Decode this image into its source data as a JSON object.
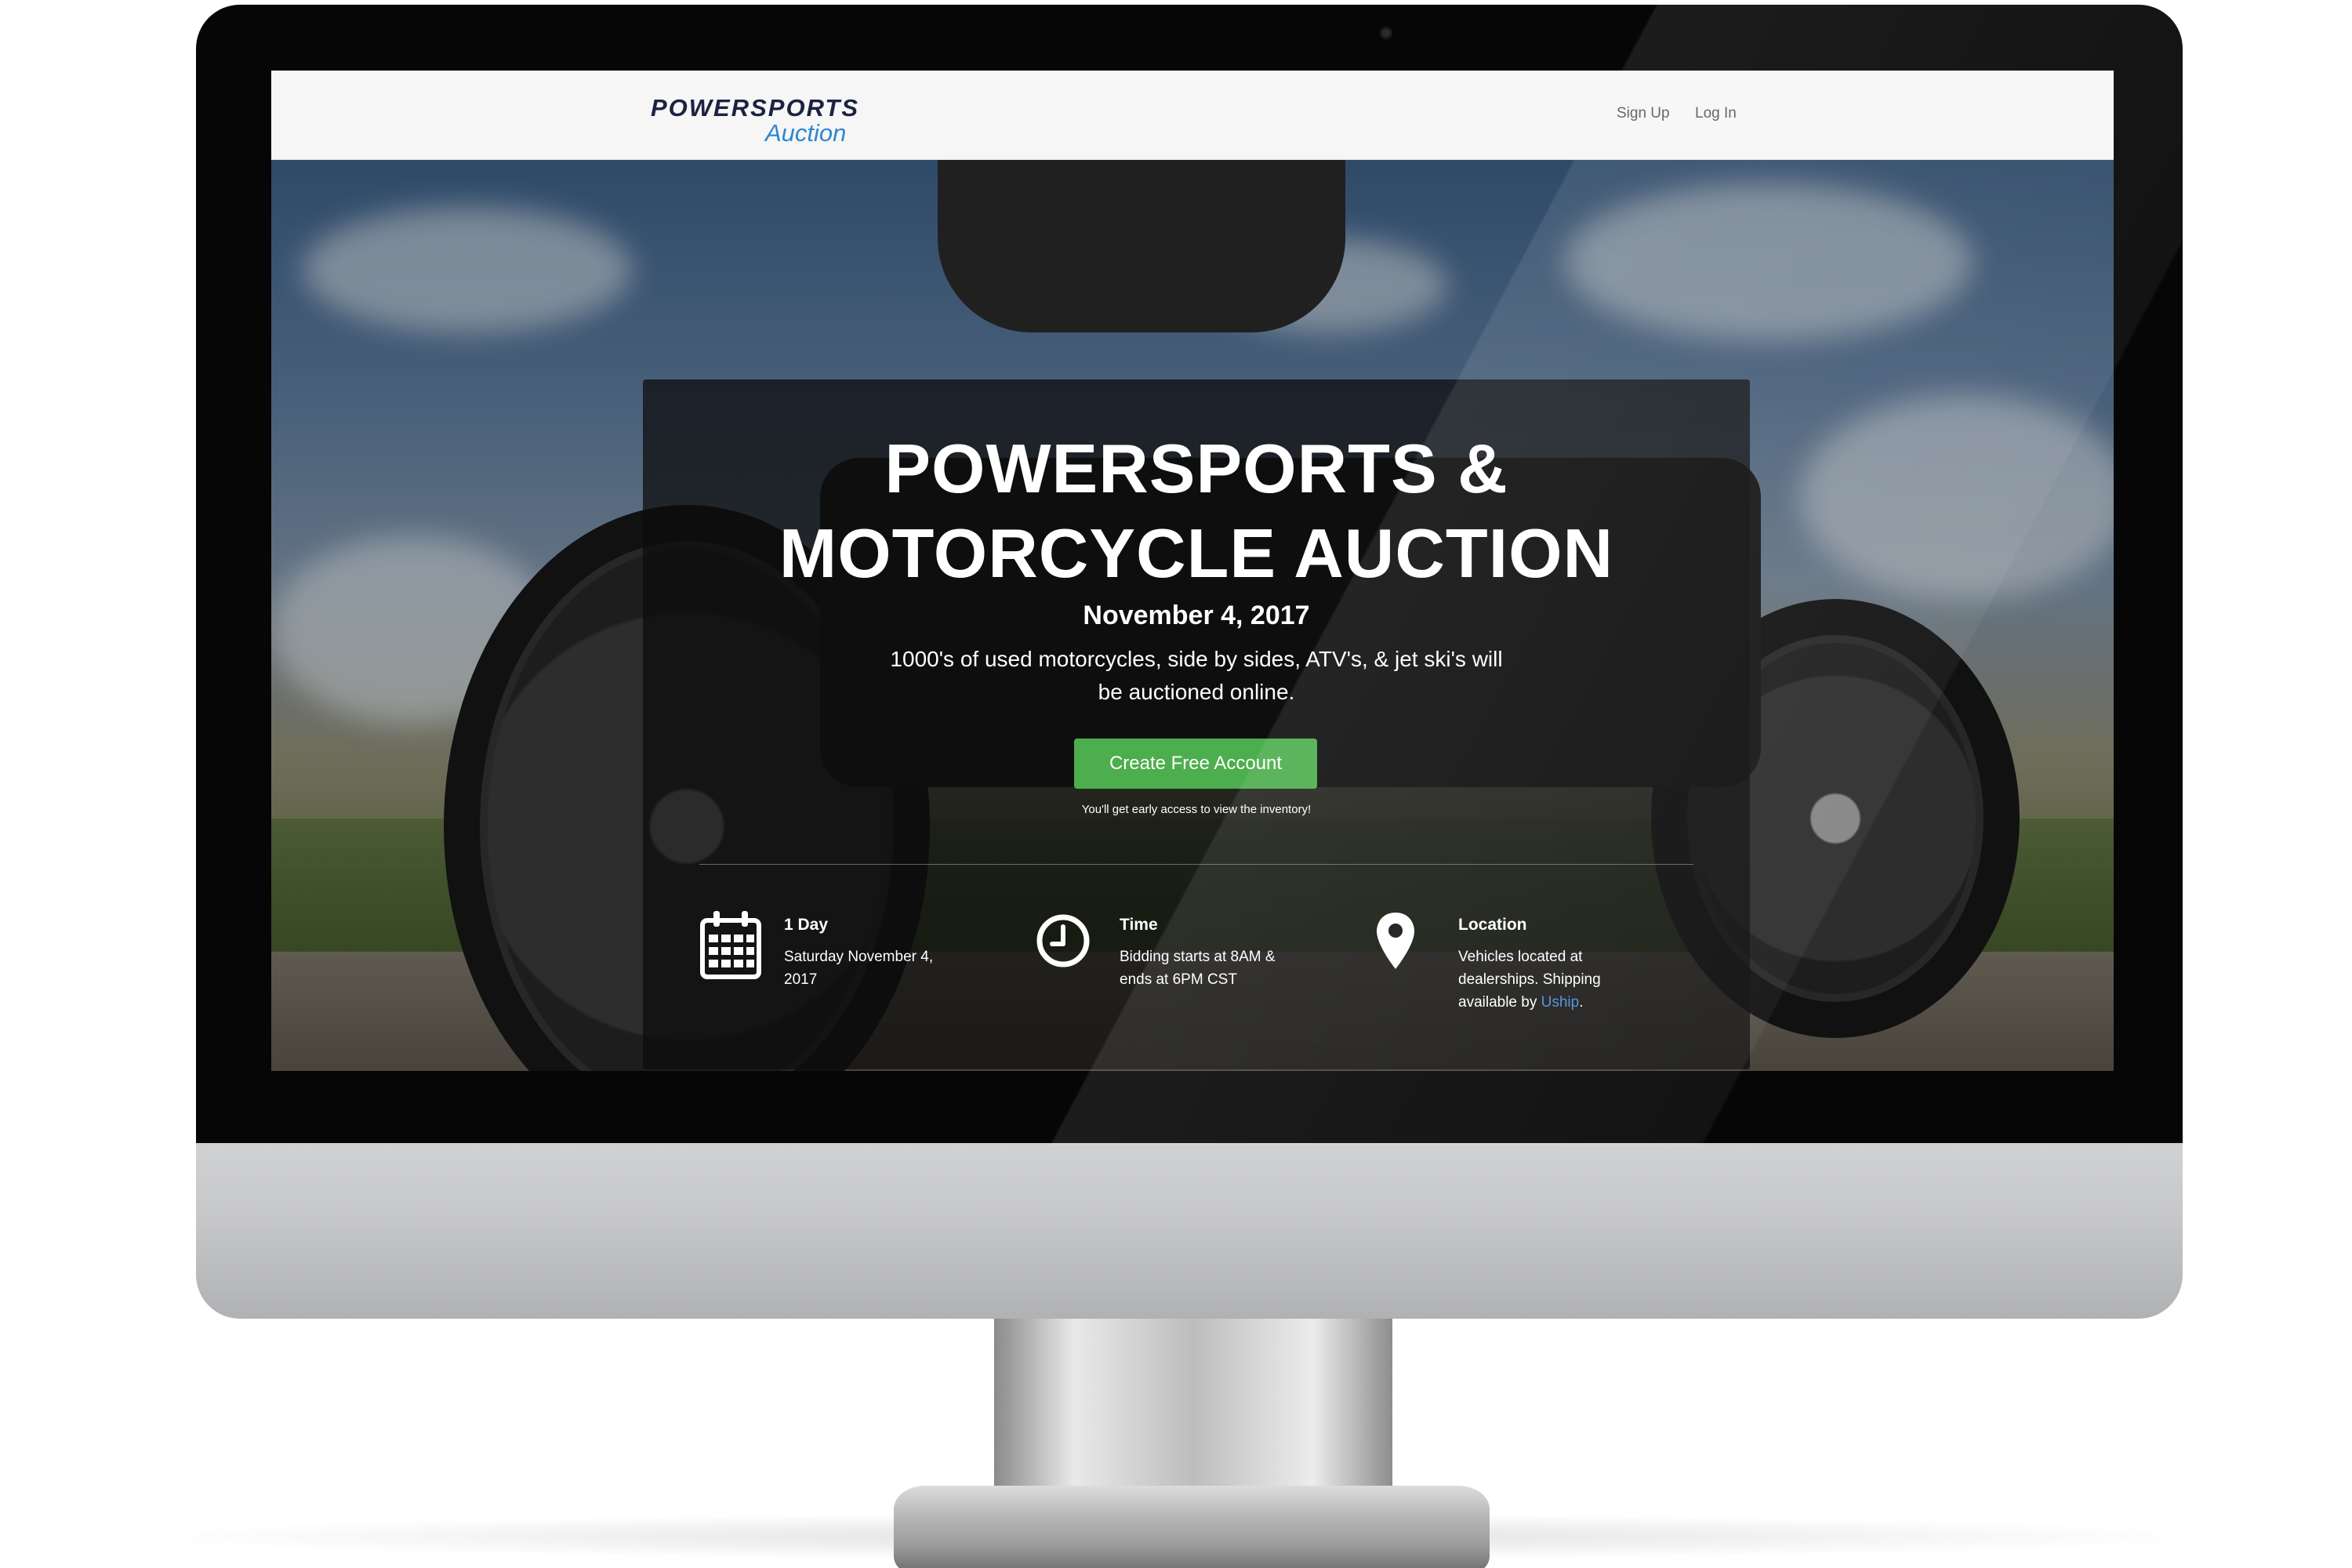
{
  "navbar": {
    "logo_top": "POWERSPORTS",
    "logo_bottom": "Auction",
    "signup_label": "Sign Up",
    "login_label": "Log In"
  },
  "hero": {
    "title_line1": "POWERSPORTS &",
    "title_line2": "MOTORCYCLE AUCTION",
    "date": "November 4, 2017",
    "description": "1000's of used motorcycles, side by sides, ATV's, & jet ski's will be auctioned online.",
    "cta_label": "Create Free Account",
    "cta_note": "You'll get early access to view the inventory!"
  },
  "features": [
    {
      "icon": "calendar-icon",
      "title": "1 Day",
      "text": "Saturday November 4, 2017"
    },
    {
      "icon": "clock-icon",
      "title": "Time",
      "text": "Bidding starts at 8AM & ends at 6PM CST"
    },
    {
      "icon": "map-pin-icon",
      "title": "Location",
      "text_before": "Vehicles located at dealerships. Shipping available by ",
      "link": "Uship",
      "text_after": "."
    }
  ],
  "colors": {
    "cta_green": "#4cae4c",
    "logo_navy": "#1c2340",
    "logo_blue": "#2e86d0",
    "link_blue": "#4a90d9"
  }
}
